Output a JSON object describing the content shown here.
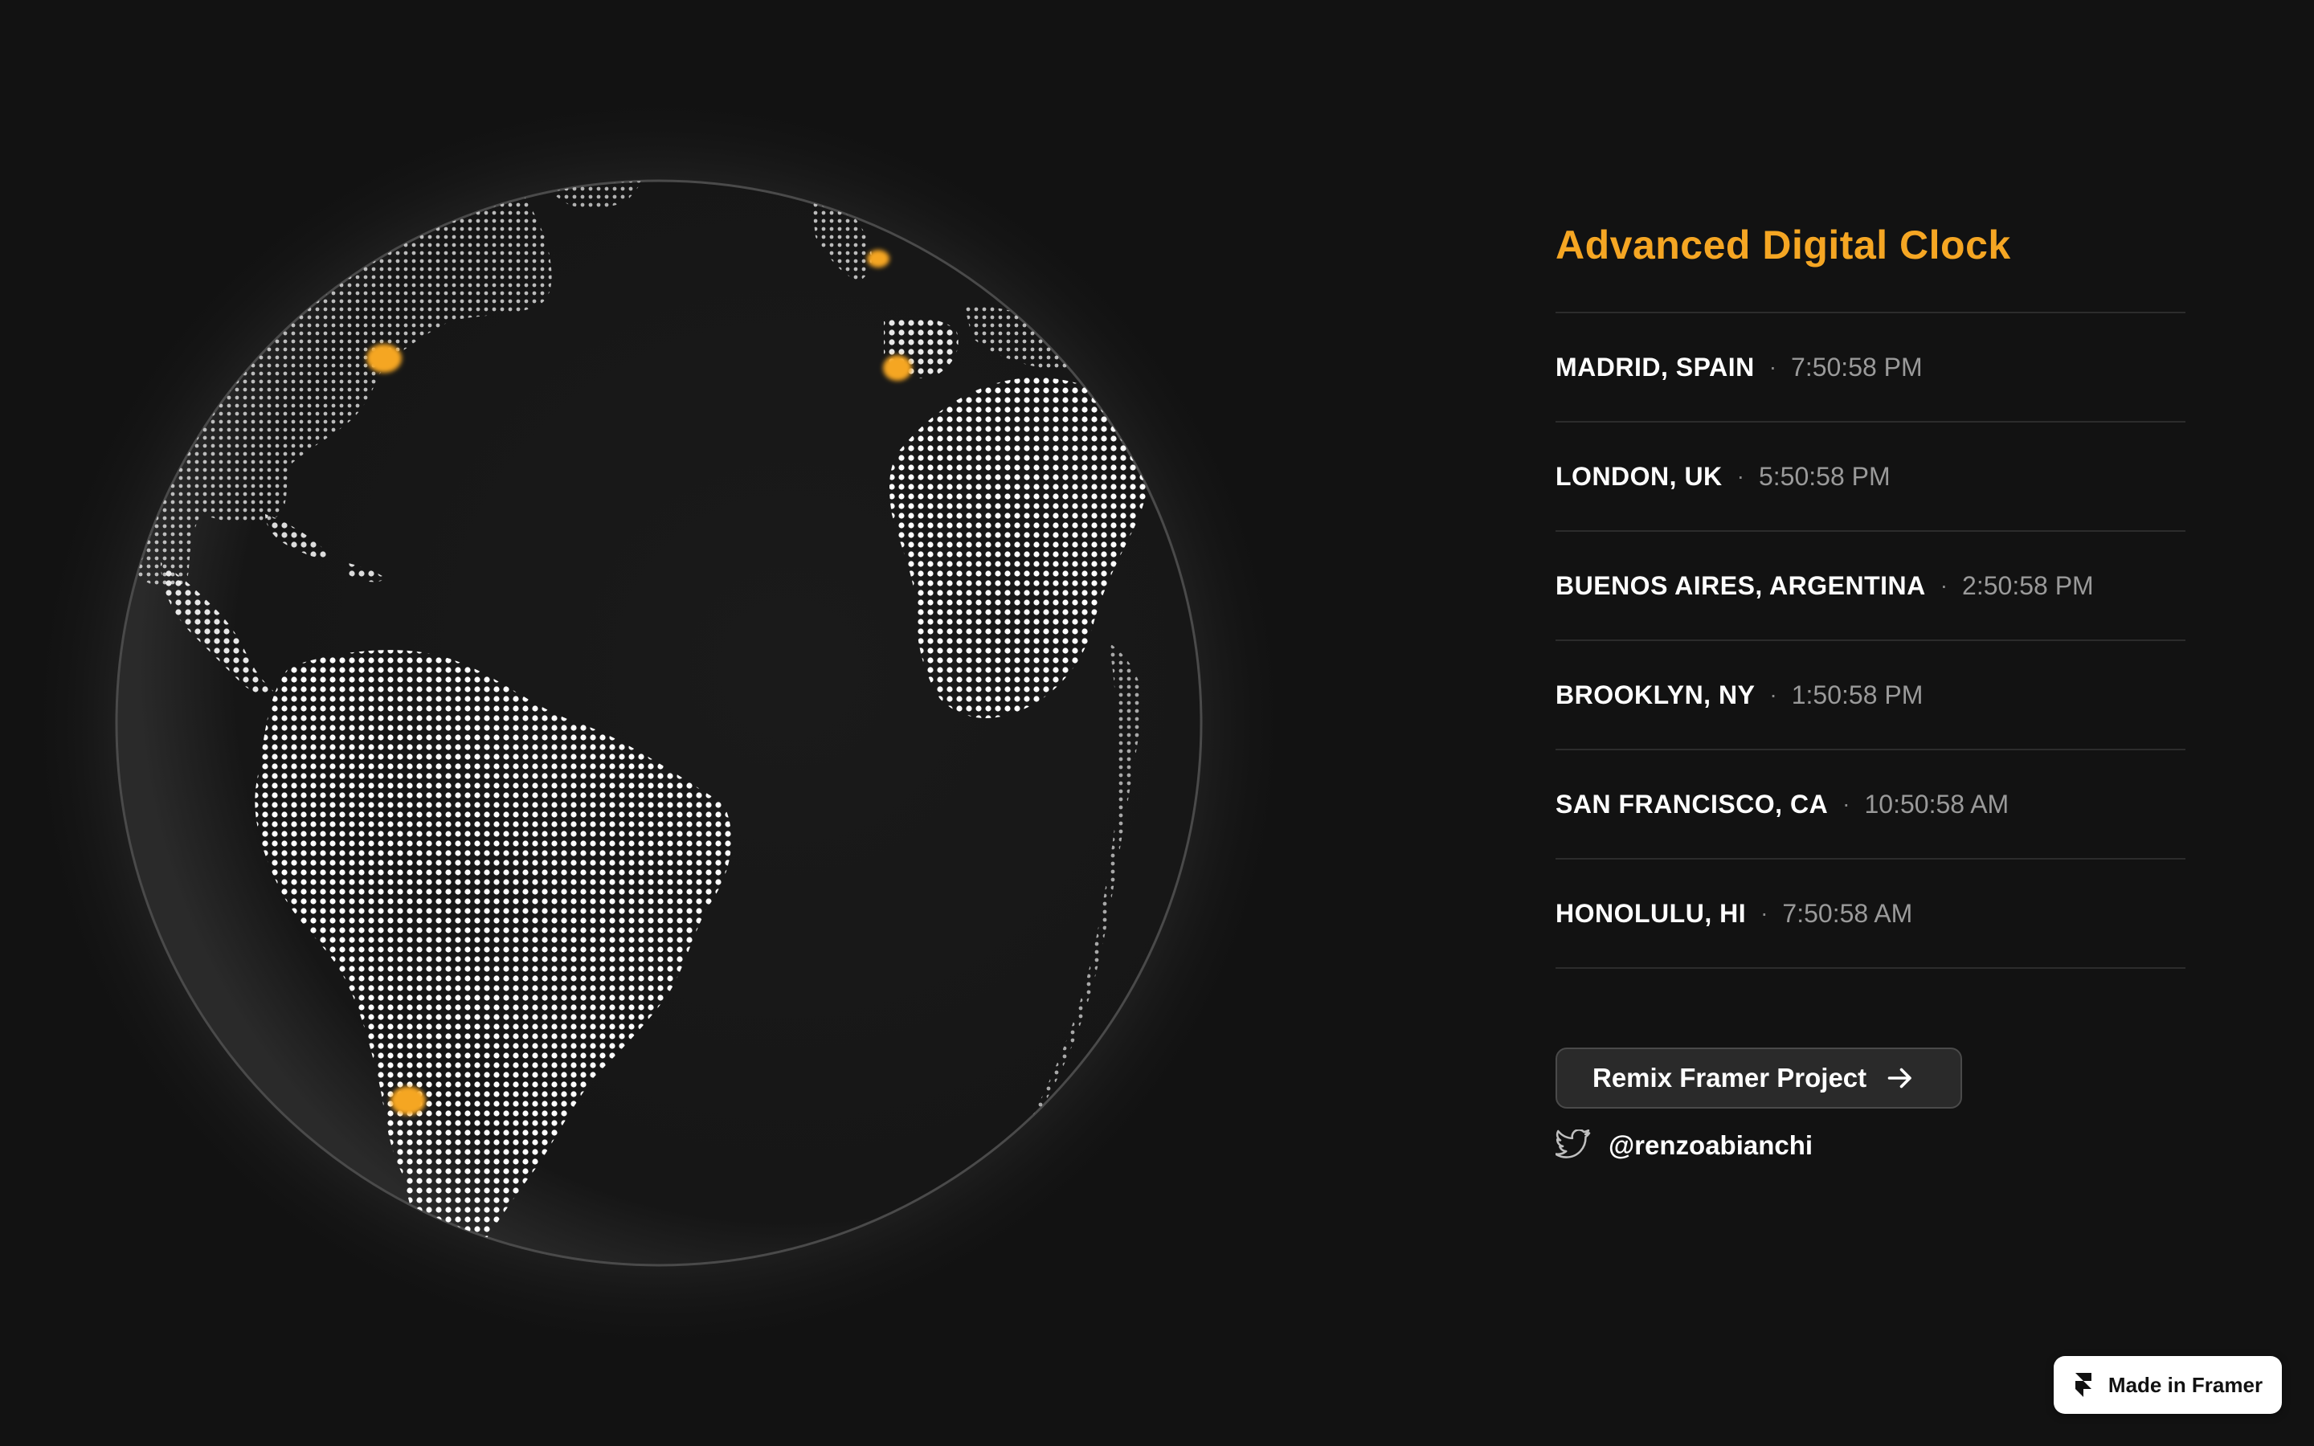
{
  "title": "Advanced Digital Clock",
  "cities": [
    {
      "name": "MADRID, SPAIN",
      "time": "7:50:58 PM"
    },
    {
      "name": "LONDON, UK",
      "time": "5:50:58 PM"
    },
    {
      "name": "BUENOS AIRES, ARGENTINA",
      "time": "2:50:58 PM"
    },
    {
      "name": "BROOKLYN, NY",
      "time": "1:50:58 PM"
    },
    {
      "name": "SAN FRANCISCO, CA",
      "time": "10:50:58 AM"
    },
    {
      "name": "HONOLULU, HI",
      "time": "7:50:58 AM"
    }
  ],
  "separator": "·",
  "remix_button": {
    "label": "Remix Framer Project",
    "icon": "arrow-right-icon"
  },
  "twitter": {
    "handle": "@renzoabianchi",
    "icon": "twitter-bird-icon"
  },
  "framer_badge": {
    "label": "Made in Framer",
    "icon": "framer-logo-icon"
  },
  "colors": {
    "background": "#121212",
    "accent": "#f5a623",
    "text": "#ffffff",
    "muted": "#9a9a9a",
    "divider": "#2c2c2c"
  }
}
